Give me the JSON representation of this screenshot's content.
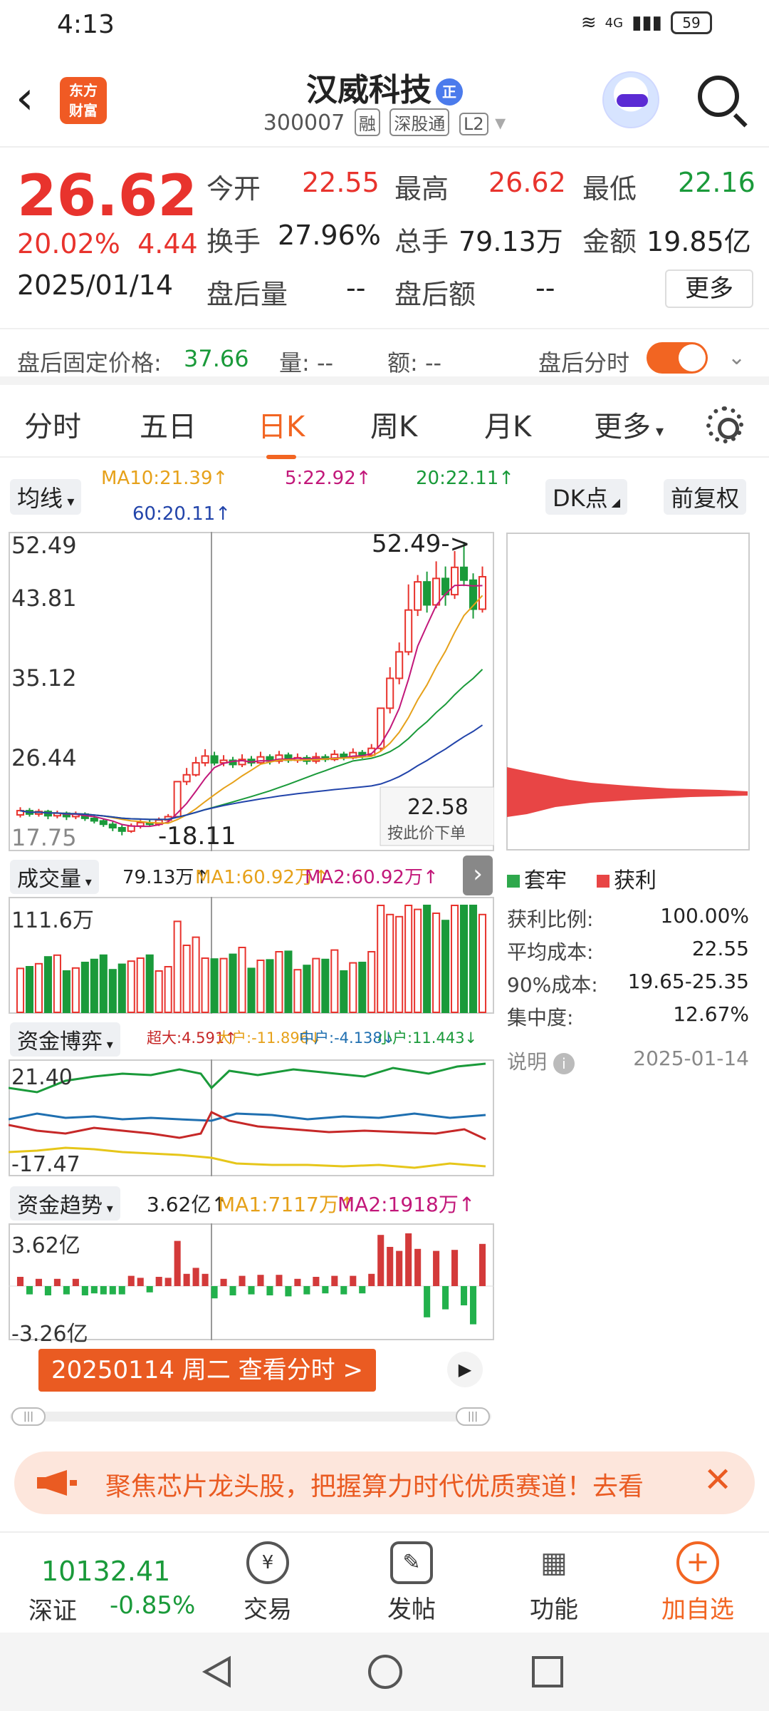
{
  "status": {
    "time": "4:13",
    "network": "4G",
    "battery": "59"
  },
  "header": {
    "name": "汉威科技",
    "badge": "正",
    "code": "300007",
    "tags": [
      "融",
      "深股通",
      "L2"
    ],
    "logo_line1": "东方",
    "logo_line2": "财富"
  },
  "quote": {
    "price": "26.62",
    "change_pct": "20.02%",
    "change_abs": "4.44",
    "date": "2025/01/14",
    "open_label": "今开",
    "open": "22.55",
    "high_label": "最高",
    "high": "26.62",
    "low_label": "最低",
    "low": "22.16",
    "turnover_label": "换手",
    "turnover": "27.96%",
    "volume_label": "总手",
    "volume": "79.13万",
    "amount_label": "金额",
    "amount": "19.85亿",
    "ah_vol_label": "盘后量",
    "ah_vol": "--",
    "ah_amt_label": "盘后额",
    "ah_amt": "--",
    "more": "更多"
  },
  "afterhours": {
    "fixed_price_label": "盘后固定价格:",
    "fixed_price": "37.66",
    "vol_label": "量: --",
    "amt_label": "额: --",
    "timeshare_label": "盘后分时"
  },
  "tabs": [
    "分时",
    "五日",
    "日K",
    "周K",
    "月K",
    "更多"
  ],
  "kline": {
    "indicator_select": "均线",
    "ma10": "MA10:21.39↑",
    "ma5": "5:22.92↑",
    "ma20": "20:22.11↑",
    "ma60": "60:20.11↑",
    "dk_button": "DK点",
    "adjust_button": "前复权",
    "y_labels": [
      "52.49",
      "43.81",
      "35.12",
      "26.44",
      "17.75"
    ],
    "max_callout": "52.49->",
    "min_callout": "-18.11",
    "price_tip": "22.58",
    "price_tip_sub": "按此价下单",
    "candles": [
      {
        "o": 20.5,
        "c": 21.0,
        "h": 21.4,
        "l": 20.2
      },
      {
        "o": 21.0,
        "c": 20.6,
        "h": 21.3,
        "l": 20.3
      },
      {
        "o": 20.6,
        "c": 20.9,
        "h": 21.2,
        "l": 20.3
      },
      {
        "o": 20.9,
        "c": 20.4,
        "h": 21.1,
        "l": 20.0
      },
      {
        "o": 20.4,
        "c": 20.7,
        "h": 21.0,
        "l": 20.1
      },
      {
        "o": 20.7,
        "c": 20.3,
        "h": 20.9,
        "l": 19.9
      },
      {
        "o": 20.3,
        "c": 20.6,
        "h": 20.9,
        "l": 20.0
      },
      {
        "o": 20.6,
        "c": 20.1,
        "h": 20.8,
        "l": 19.8
      },
      {
        "o": 20.1,
        "c": 19.8,
        "h": 20.4,
        "l": 19.5
      },
      {
        "o": 19.8,
        "c": 19.4,
        "h": 20.0,
        "l": 19.1
      },
      {
        "o": 19.4,
        "c": 19.0,
        "h": 19.7,
        "l": 18.6
      },
      {
        "o": 19.0,
        "c": 18.6,
        "h": 19.3,
        "l": 18.11
      },
      {
        "o": 18.6,
        "c": 19.2,
        "h": 19.5,
        "l": 18.4
      },
      {
        "o": 19.2,
        "c": 19.6,
        "h": 19.9,
        "l": 18.9
      },
      {
        "o": 19.6,
        "c": 19.4,
        "h": 20.0,
        "l": 19.1
      },
      {
        "o": 19.4,
        "c": 19.9,
        "h": 20.2,
        "l": 19.2
      },
      {
        "o": 19.9,
        "c": 20.3,
        "h": 20.6,
        "l": 19.6
      },
      {
        "o": 20.3,
        "c": 24.4,
        "h": 24.4,
        "l": 20.2
      },
      {
        "o": 24.4,
        "c": 25.2,
        "h": 26.0,
        "l": 24.0
      },
      {
        "o": 25.2,
        "c": 26.6,
        "h": 27.3,
        "l": 25.0
      },
      {
        "o": 26.6,
        "c": 27.4,
        "h": 28.2,
        "l": 26.2
      },
      {
        "o": 27.4,
        "c": 26.6,
        "h": 27.9,
        "l": 26.3
      },
      {
        "o": 26.6,
        "c": 26.9,
        "h": 27.5,
        "l": 26.2
      },
      {
        "o": 26.9,
        "c": 26.4,
        "h": 27.3,
        "l": 26.0
      },
      {
        "o": 26.4,
        "c": 27.0,
        "h": 27.6,
        "l": 26.1
      },
      {
        "o": 27.0,
        "c": 26.6,
        "h": 27.4,
        "l": 26.2
      },
      {
        "o": 26.6,
        "c": 27.3,
        "h": 27.9,
        "l": 26.4
      },
      {
        "o": 27.3,
        "c": 26.8,
        "h": 27.6,
        "l": 26.4
      },
      {
        "o": 26.8,
        "c": 27.5,
        "h": 28.0,
        "l": 26.5
      },
      {
        "o": 27.5,
        "c": 26.9,
        "h": 27.8,
        "l": 26.6
      },
      {
        "o": 26.9,
        "c": 27.2,
        "h": 27.7,
        "l": 26.6
      },
      {
        "o": 27.2,
        "c": 26.8,
        "h": 27.5,
        "l": 26.4
      },
      {
        "o": 26.8,
        "c": 27.3,
        "h": 27.8,
        "l": 26.5
      },
      {
        "o": 27.3,
        "c": 27.0,
        "h": 27.6,
        "l": 26.7
      },
      {
        "o": 27.0,
        "c": 27.6,
        "h": 28.1,
        "l": 26.8
      },
      {
        "o": 27.6,
        "c": 27.2,
        "h": 27.9,
        "l": 26.9
      },
      {
        "o": 27.2,
        "c": 27.8,
        "h": 28.3,
        "l": 27.0
      },
      {
        "o": 27.8,
        "c": 27.5,
        "h": 28.1,
        "l": 27.1
      },
      {
        "o": 27.5,
        "c": 28.3,
        "h": 28.8,
        "l": 27.3
      },
      {
        "o": 28.3,
        "c": 33.0,
        "h": 33.0,
        "l": 28.0
      },
      {
        "o": 33.0,
        "c": 36.5,
        "h": 37.8,
        "l": 32.4
      },
      {
        "o": 36.5,
        "c": 39.6,
        "h": 40.7,
        "l": 35.8
      },
      {
        "o": 39.6,
        "c": 44.5,
        "h": 47.5,
        "l": 39.2
      },
      {
        "o": 44.5,
        "c": 47.8,
        "h": 48.6,
        "l": 43.8
      },
      {
        "o": 47.8,
        "c": 45.1,
        "h": 49.0,
        "l": 44.2
      },
      {
        "o": 45.1,
        "c": 48.2,
        "h": 50.2,
        "l": 44.7
      },
      {
        "o": 48.2,
        "c": 46.3,
        "h": 49.6,
        "l": 45.0
      },
      {
        "o": 46.3,
        "c": 49.5,
        "h": 51.4,
        "l": 45.8
      },
      {
        "o": 49.5,
        "c": 48.0,
        "h": 52.49,
        "l": 47.3
      },
      {
        "o": 48.0,
        "c": 44.6,
        "h": 48.8,
        "l": 43.5
      },
      {
        "o": 44.6,
        "c": 48.4,
        "h": 49.6,
        "l": 44.2
      }
    ]
  },
  "chips": {
    "legend_locked": "套牢",
    "legend_profit": "获利",
    "rows": [
      {
        "label": "获利比例:",
        "value": "100.00%"
      },
      {
        "label": "平均成本:",
        "value": "22.55"
      },
      {
        "label": "90%成本:",
        "value": "19.65-25.35"
      },
      {
        "label": "集中度:",
        "value": "12.67%"
      }
    ],
    "note_label": "说明",
    "note_date": "2025-01-14"
  },
  "volume": {
    "select": "成交量",
    "value": "79.13万↑",
    "ma1": "MA1:60.92万↑",
    "ma2": "MA2:60.92万↑",
    "y_max": "111.6万"
  },
  "capital_game": {
    "select": "资金博弈",
    "super": "超大:4.591↑",
    "large": "大户:-11.896↓",
    "mid": "中户:-4.138↓",
    "small": "小户:11.443↓",
    "y_top": "21.40",
    "y_bottom": "-17.47"
  },
  "capital_trend": {
    "select": "资金趋势",
    "value": "3.62亿↑",
    "ma1": "MA1:7117万↑",
    "ma2": "MA2:1918万↑",
    "y_top": "3.62亿",
    "y_bottom": "-3.26亿"
  },
  "date_tip": "20250114 周二 查看分时 >",
  "banner": {
    "text": "聚焦芯片龙头股，把握算力时代优质赛道！去看"
  },
  "bottom": {
    "index_value": "10132.41",
    "index_name": "深证",
    "index_change": "-0.85%",
    "trade": "交易",
    "post": "发帖",
    "func": "功能",
    "add": "加自选"
  },
  "colors": {
    "accent": "#f26522",
    "up": "#e8332d",
    "down": "#1a9a3a"
  }
}
